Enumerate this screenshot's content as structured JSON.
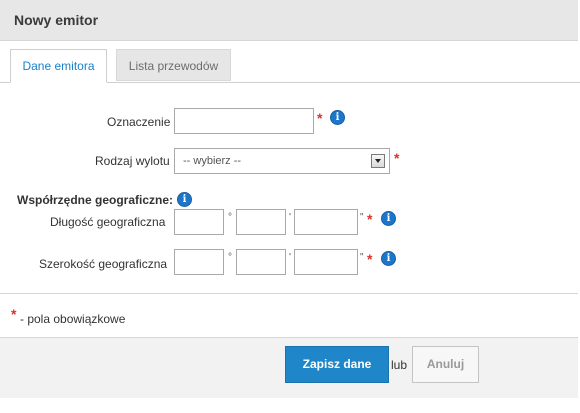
{
  "window": {
    "title": "Nowy emitor"
  },
  "tabs": [
    {
      "label": "Dane emitora",
      "active": true
    },
    {
      "label": "Lista przewodów",
      "active": false
    }
  ],
  "form": {
    "oznaczenie": {
      "label": "Oznaczenie",
      "value": "",
      "required_mark": "*"
    },
    "rodzaj_wylotu": {
      "label": "Rodzaj wylotu",
      "selected": "-- wybierz --",
      "required_mark": "*"
    },
    "geo_header": "Współrzędne geograficzne:",
    "dlugosc": {
      "label": "Długość geograficzna",
      "deg_sep": "°",
      "min_sep": "'",
      "sec_sep": "\"",
      "required_mark": "*"
    },
    "szerokosc": {
      "label": "Szerokość geograficzna",
      "deg_sep": "°",
      "min_sep": "'",
      "sec_sep": "\"",
      "required_mark": "*"
    },
    "info_glyph": "i"
  },
  "legend": {
    "mark": "*",
    "text": "- pola obowiązkowe"
  },
  "footer": {
    "save_label": "Zapisz dane",
    "or_text": "lub",
    "cancel_label": "Anuluj"
  },
  "colors": {
    "accent": "#1f86c9",
    "required": "#d9342b",
    "tab_active_text": "#1a7fc9"
  }
}
